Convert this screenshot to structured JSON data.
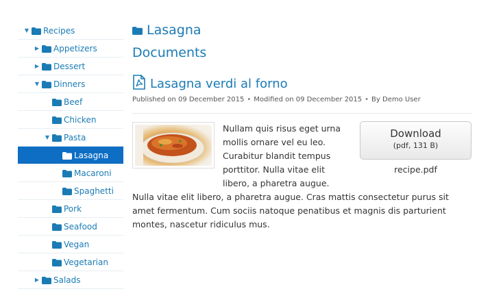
{
  "tree": {
    "root": "Recipes",
    "items": [
      {
        "label": "Appetizers",
        "level": 1,
        "toggle": "collapsed"
      },
      {
        "label": "Dessert",
        "level": 1,
        "toggle": "collapsed"
      },
      {
        "label": "Dinners",
        "level": 1,
        "toggle": "expanded"
      },
      {
        "label": "Beef",
        "level": 2,
        "toggle": "none"
      },
      {
        "label": "Chicken",
        "level": 2,
        "toggle": "none"
      },
      {
        "label": "Pasta",
        "level": 2,
        "toggle": "expanded"
      },
      {
        "label": "Lasagna",
        "level": 3,
        "toggle": "none",
        "active": true
      },
      {
        "label": "Macaroni",
        "level": 3,
        "toggle": "none"
      },
      {
        "label": "Spaghetti",
        "level": 3,
        "toggle": "none"
      },
      {
        "label": "Pork",
        "level": 2,
        "toggle": "none"
      },
      {
        "label": "Seafood",
        "level": 2,
        "toggle": "none"
      },
      {
        "label": "Vegan",
        "level": 2,
        "toggle": "none"
      },
      {
        "label": "Vegetarian",
        "level": 2,
        "toggle": "none"
      },
      {
        "label": "Salads",
        "level": 1,
        "toggle": "collapsed"
      }
    ]
  },
  "category_title": "Lasagna",
  "section_title": "Documents",
  "document": {
    "title": "Lasagna verdi al forno",
    "published": "Published on 09 December 2015",
    "modified": "Modified on 09 December 2015",
    "author": "By Demo User",
    "separator": "•",
    "body": "Nullam quis risus eget urna mollis ornare vel eu leo. Curabitur blandit tempus porttitor. Nulla vitae elit libero, a pharetra augue. Nulla vitae elit libero, a pharetra augue. Cras mattis consectetur purus sit amet fermentum. Cum sociis natoque penatibus et magnis dis parturient montes, nascetur ridiculus mus."
  },
  "download": {
    "label": "Download",
    "detail": "(pdf, 131 B)",
    "filename": "recipe.pdf"
  },
  "colors": {
    "link": "#1a7bb5",
    "active": "#0d6ec4"
  },
  "icons": {
    "folder": "folder-icon",
    "pdf": "pdf-icon",
    "expand": "caret-down-icon",
    "collapse": "caret-right-icon"
  }
}
